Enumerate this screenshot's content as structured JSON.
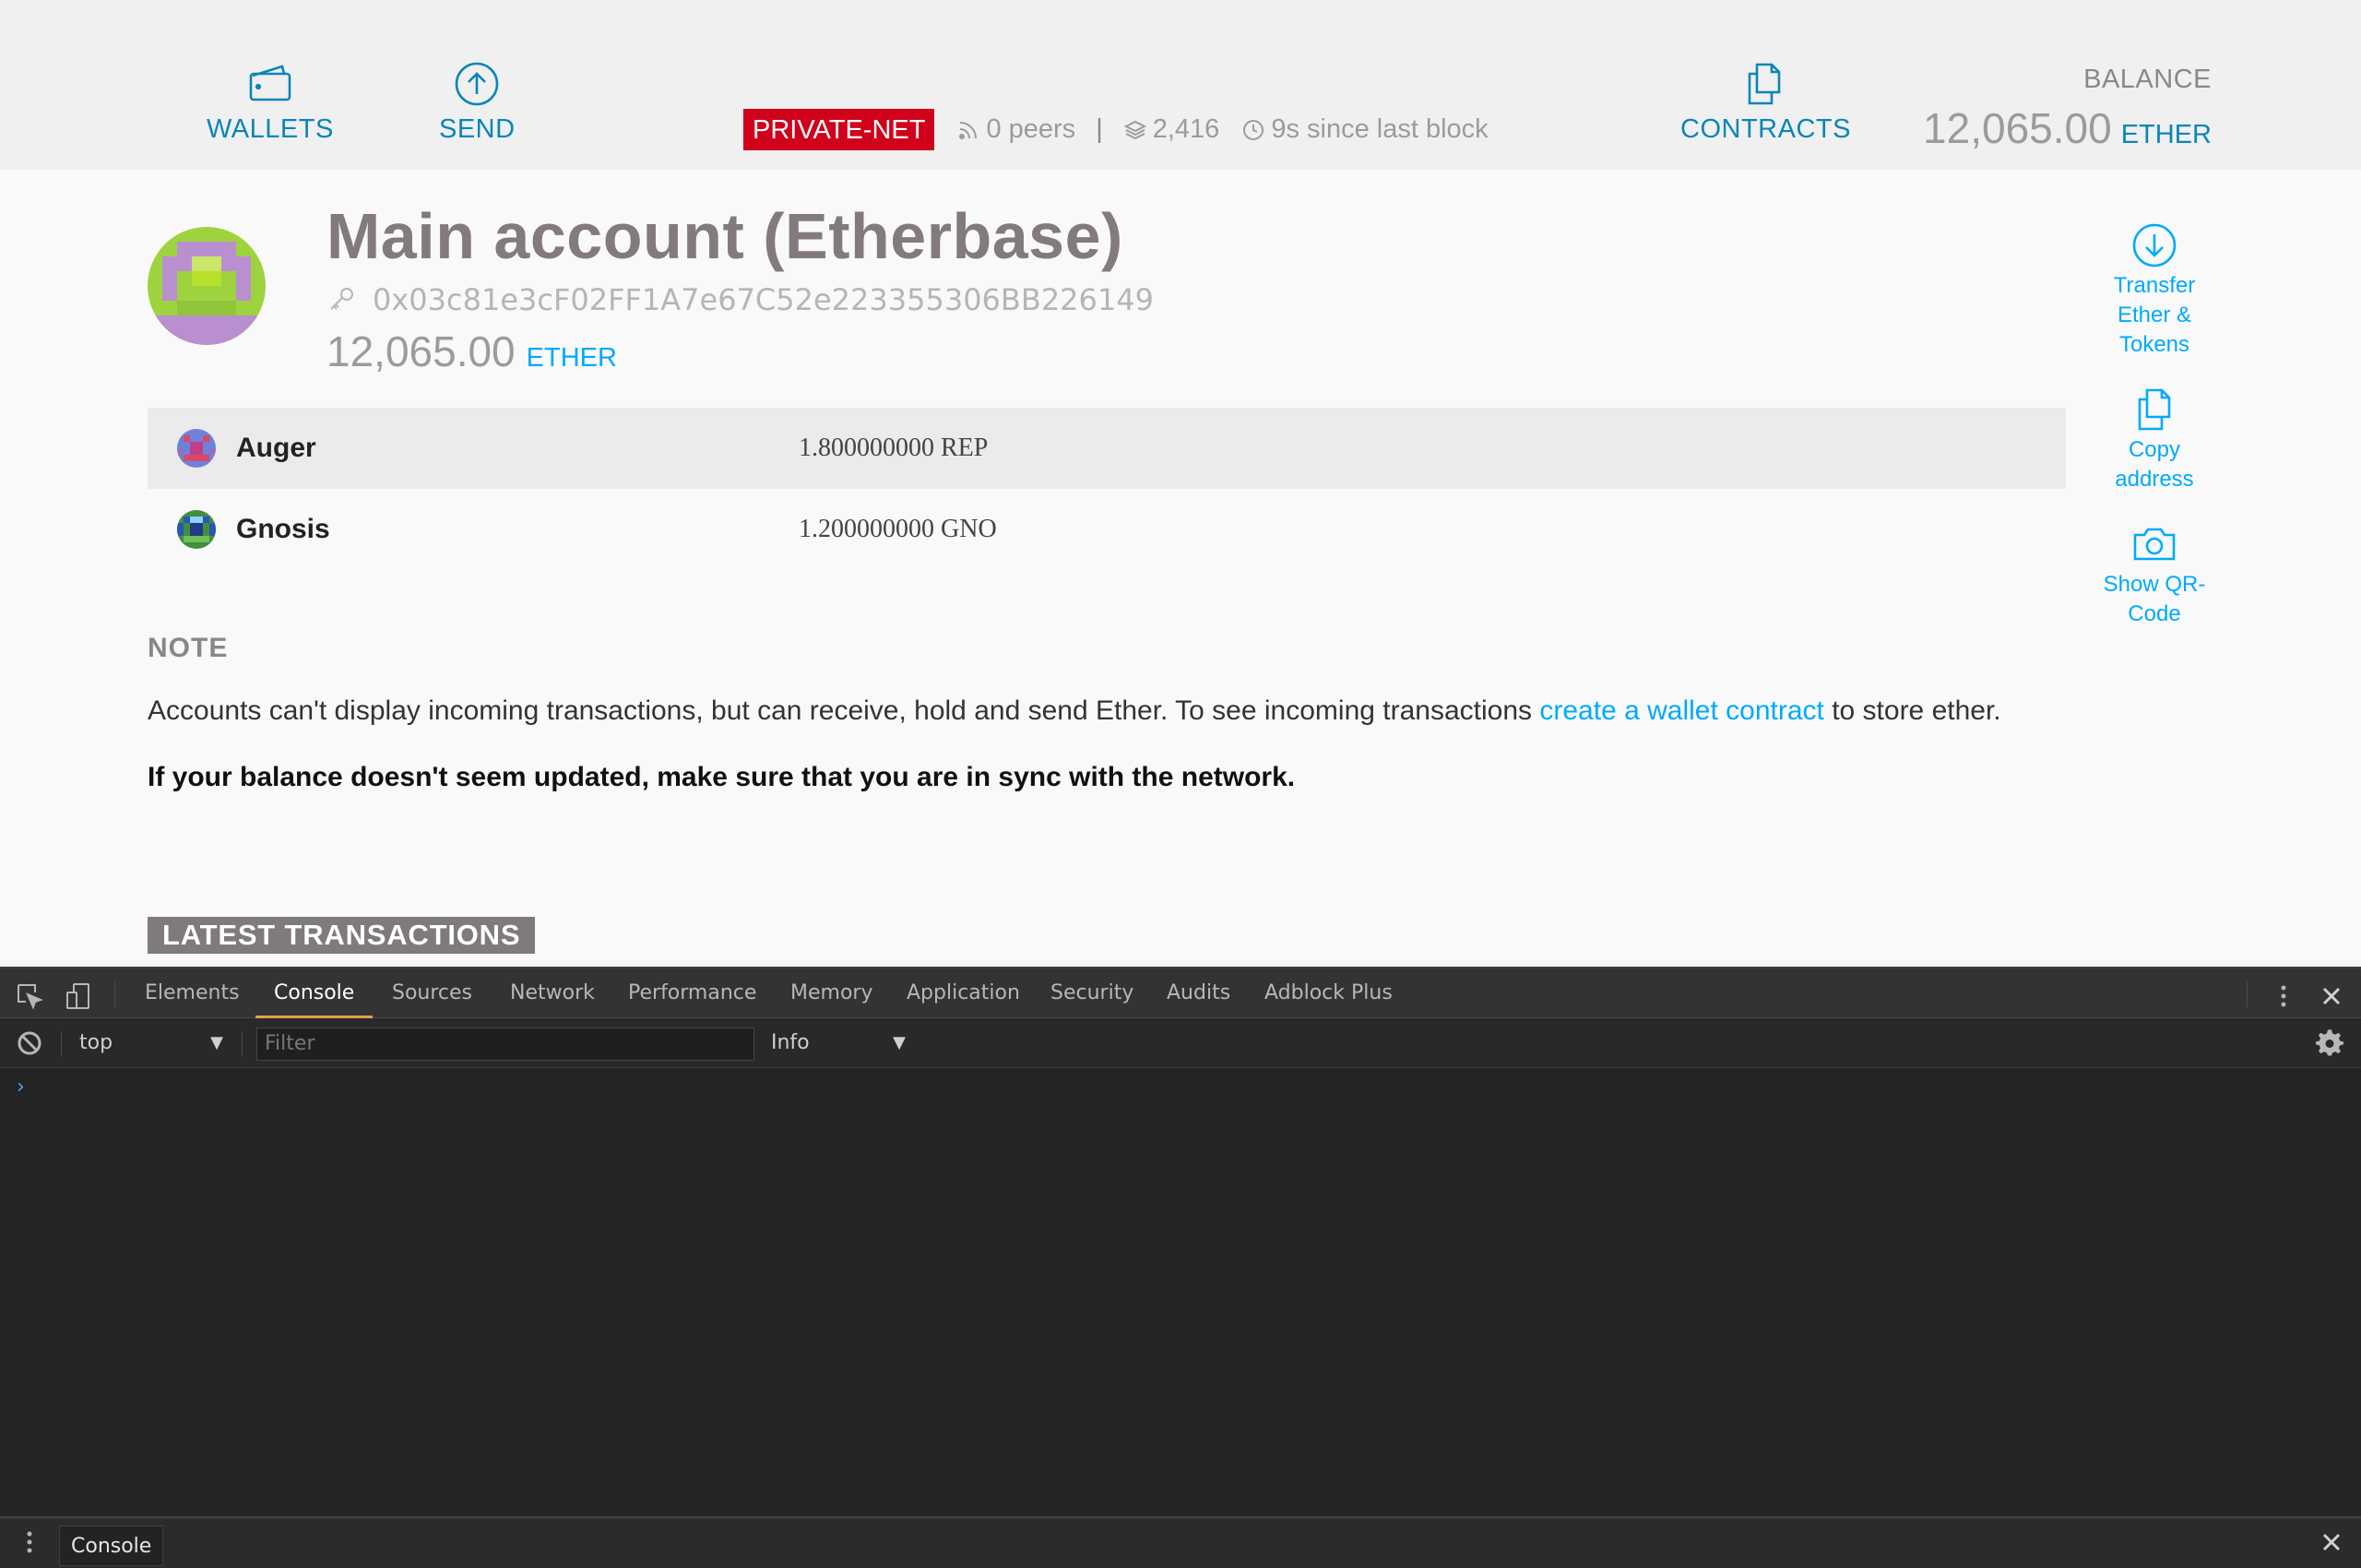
{
  "nav": {
    "wallets": "WALLETS",
    "send": "SEND",
    "contracts": "CONTRACTS"
  },
  "network": {
    "name": "PRIVATE-NET",
    "peers": "0 peers",
    "separator": "|",
    "block": "2,416",
    "since_block": "9s since last block"
  },
  "balance": {
    "label": "BALANCE",
    "value": "12,065.00",
    "unit": "ETHER"
  },
  "account": {
    "title": "Main account (Etherbase)",
    "address": "0x03c81e3cF02FF1A7e67C52e223355306BB226149",
    "balance": "12,065.00",
    "unit": "ETHER"
  },
  "tokens": [
    {
      "name": "Auger",
      "balance": "1.800000000 REP"
    },
    {
      "name": "Gnosis",
      "balance": "1.200000000 GNO"
    }
  ],
  "note": {
    "title": "NOTE",
    "text_before": "Accounts can't display incoming transactions, but can receive, hold and send Ether. To see incoming transactions ",
    "link": "create a wallet contract",
    "text_after": " to store ether.",
    "warning": "If your balance doesn't seem updated, make sure that you are in sync with the network."
  },
  "latest_transactions": "LATEST TRANSACTIONS",
  "actions": {
    "transfer": [
      "Transfer",
      "Ether &",
      "Tokens"
    ],
    "copy": [
      "Copy",
      "address"
    ],
    "qr": [
      "Show QR-",
      "Code"
    ]
  },
  "devtools": {
    "tabs": [
      "Elements",
      "Console",
      "Sources",
      "Network",
      "Performance",
      "Memory",
      "Application",
      "Security",
      "Audits",
      "Adblock Plus"
    ],
    "active_tab": "Console",
    "context": "top",
    "filter_placeholder": "Filter",
    "level": "Info",
    "prompt": "›",
    "drawer_tab": "Console"
  },
  "colors": {
    "accent": "#0a85b8",
    "link": "#00aafa",
    "net_badge": "#d0021b",
    "devtools_bg": "#242424"
  },
  "icons": {
    "wallets": "wallet-icon",
    "send": "send-arrow-up-icon",
    "contracts": "contracts-documents-icon",
    "peers": "rss-icon",
    "block": "layers-icon",
    "time": "clock-icon",
    "key": "key-icon",
    "transfer": "download-circle-icon",
    "copy": "copy-documents-icon",
    "qr": "camera-icon"
  }
}
